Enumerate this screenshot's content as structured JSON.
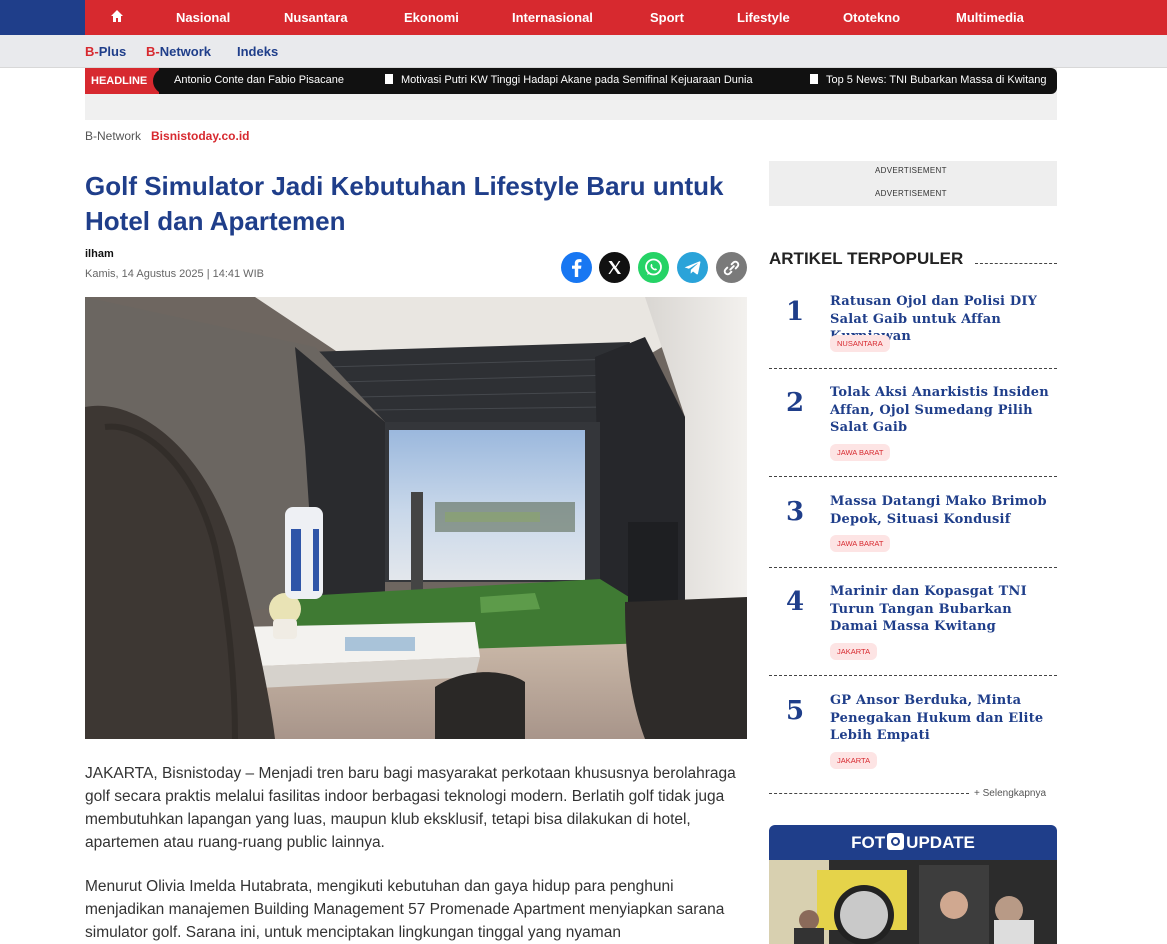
{
  "nav": {
    "items": [
      "Nasional",
      "Nusantara",
      "Ekonomi",
      "Internasional",
      "Sport",
      "Lifestyle",
      "Ototekno",
      "Multimedia"
    ],
    "home_icon": "home-icon"
  },
  "subnav": {
    "bplus_prefix": "B-",
    "bplus_suffix": "Plus",
    "bnetwork_prefix": "B-",
    "bnetwork_suffix": "Network",
    "indeks": "Indeks"
  },
  "ticker": {
    "label": "HEADLINE",
    "items": [
      "Antonio Conte dan Fabio Pisacane",
      "Motivasi Putri KW Tinggi Hadapi Akane pada Semifinal Kejuaraan Dunia",
      "Top 5 News: TNI Bubarkan Massa di Kwitang"
    ]
  },
  "breadcrumb": {
    "section": "B-Network",
    "site": "Bisnistoday.co.id"
  },
  "article": {
    "title": "Golf Simulator Jadi Kebutuhan Lifestyle Baru untuk Hotel dan Apartemen",
    "author": "ilham",
    "date": "Kamis, 14 Agustus 2025 | 14:41 WIB",
    "share": [
      "facebook-icon",
      "x-icon",
      "whatsapp-icon",
      "telegram-icon",
      "link-icon"
    ],
    "paragraphs": [
      "JAKARTA, Bisnistoday – Menjadi tren baru bagi masyarakat perkotaan khususnya berolahraga golf secara praktis melalui fasilitas indoor berbagasi teknologi modern. Berlatih golf tidak juga membutuhkan lapangan yang luas, maupun klub eksklusif, tetapi bisa dilakukan di hotel, apartemen atau ruang-ruang public lainnya.",
      "Menurut Olivia Imelda Hutabrata, mengikuti kebutuhan dan gaya hidup para penghuni menjadikan manajemen Building Management 57 Promenade Apartment menyiapkan sarana simulator golf. Sarana ini, untuk menciptakan lingkungan tinggal yang nyaman"
    ]
  },
  "sidebar": {
    "ad_label_1": "ADVERTISEMENT",
    "ad_label_2": "ADVERTISEMENT",
    "popular_heading": "ARTIKEL TERPOPULER",
    "popular": [
      {
        "num": "1",
        "title": "Ratusan Ojol dan Polisi DIY Salat Gaib untuk Affan Kurniawan",
        "tag": "NUSANTARA"
      },
      {
        "num": "2",
        "title": "Tolak Aksi Anarkistis Insiden Affan, Ojol Sumedang Pilih Salat Gaib",
        "tag": "JAWA BARAT"
      },
      {
        "num": "3",
        "title": "Massa Datangi Mako Brimob Depok, Situasi Kondusif",
        "tag": "JAWA BARAT"
      },
      {
        "num": "4",
        "title": "Marinir dan Kopasgat TNI Turun Tangan Bubarkan Damai Massa Kwitang",
        "tag": "JAKARTA"
      },
      {
        "num": "5",
        "title": "GP Ansor Berduka, Minta Penegakan Hukum dan Elite Lebih Empati",
        "tag": "JAKARTA"
      }
    ],
    "more_label": "+ Selengkapnya",
    "foto_left": "FOT",
    "foto_right": "UPDATE"
  },
  "colors": {
    "brand_red": "#d7292f",
    "brand_blue": "#1f3e8a"
  }
}
